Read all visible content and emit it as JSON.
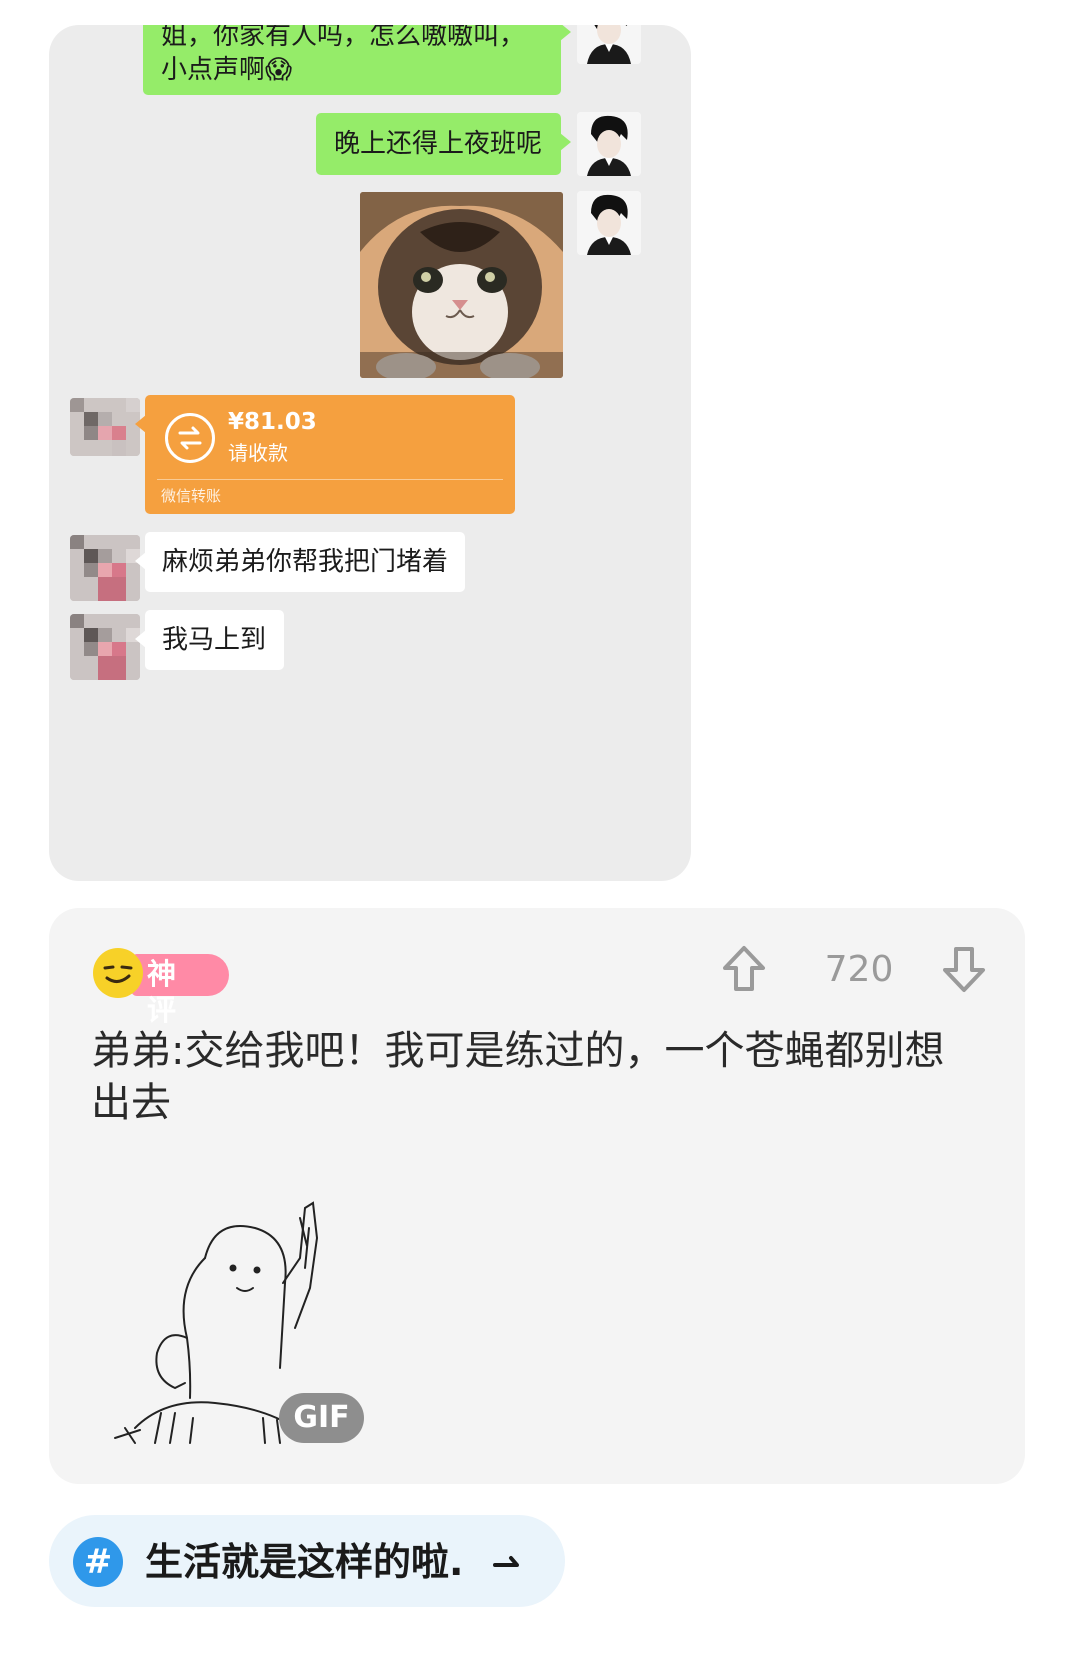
{
  "chat": {
    "messages": [
      {
        "side": "right",
        "type": "text",
        "text": "姐，你家有人吗，怎么嗷嗷叫，小点声啊😱"
      },
      {
        "side": "right",
        "type": "text",
        "text": "晚上还得上夜班呢"
      },
      {
        "side": "right",
        "type": "image",
        "alt": "crying cat photo"
      },
      {
        "side": "left",
        "type": "transfer",
        "amount": "¥81.03",
        "note": "请收款",
        "footer": "微信转账"
      },
      {
        "side": "left",
        "type": "text",
        "text": "麻烦弟弟你帮我把门堵着"
      },
      {
        "side": "left",
        "type": "text",
        "text": "我马上到"
      }
    ]
  },
  "comment": {
    "badge_label": "神评",
    "vote_count": "720",
    "text": "弟弟:交给我吧！我可是练过的，一个苍蝇都别想出去",
    "gif_label": "GIF"
  },
  "topic": {
    "hash_symbol": "#",
    "text": "生活就是这样的啦."
  },
  "colors": {
    "green_bubble": "#95ec69",
    "transfer_orange": "#f5a03f",
    "badge_pink": "#ff8aa6",
    "topic_blue": "#2f98ea"
  },
  "icons": {
    "upvote": "arrow-up-outline-icon",
    "downvote": "arrow-down-outline-icon",
    "transfer": "exchange-circle-icon",
    "topic_arrow": "arrow-right-icon"
  }
}
